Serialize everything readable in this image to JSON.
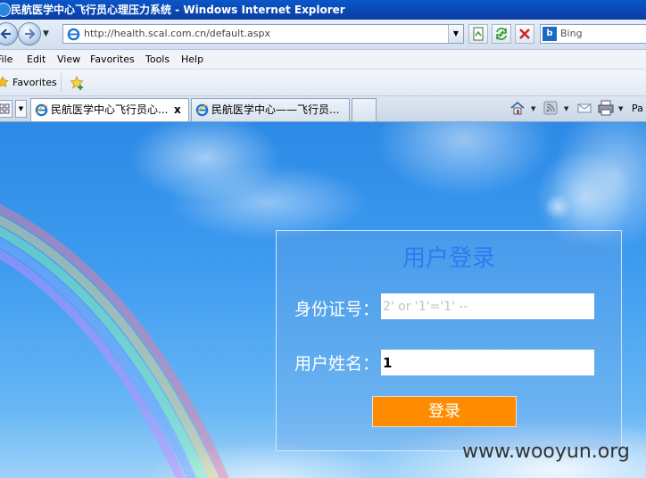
{
  "window": {
    "title": "民航医学中心飞行员心理压力系统 - Windows Internet Explorer"
  },
  "address_bar": {
    "url": "http://health.scal.com.cn/default.aspx"
  },
  "search": {
    "provider": "Bing"
  },
  "menu": {
    "items": [
      "File",
      "Edit",
      "View",
      "Favorites",
      "Tools",
      "Help"
    ]
  },
  "favorites_bar": {
    "label": "Favorites"
  },
  "tabs": [
    {
      "label": "民航医学中心飞行员心...",
      "active": true,
      "close": "x"
    },
    {
      "label": "民航医学中心——飞行员...",
      "active": false
    }
  ],
  "command_bar": {
    "page_label": "Pa"
  },
  "login": {
    "title": "用户登录",
    "id_label": "身份证号：",
    "id_value": "2' or '1'='1' --",
    "name_label": "用户姓名：",
    "name_value": "1",
    "submit_label": "登录"
  },
  "watermark": "www.wooyun.org",
  "colors": {
    "titlebar": "#0a4bbd",
    "login_title": "#2b7cf0",
    "login_button": "#ff8c00",
    "sky": "#3d9bf0"
  }
}
